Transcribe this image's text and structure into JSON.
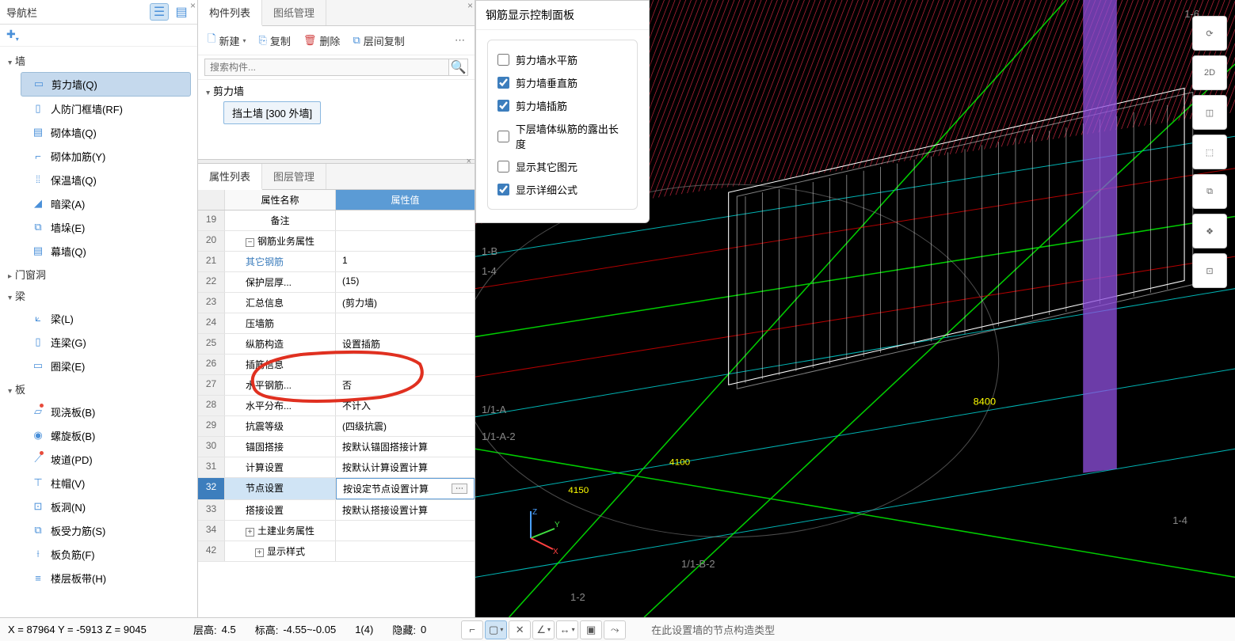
{
  "nav": {
    "title": "导航栏",
    "groups": [
      {
        "label": "墙",
        "expanded": true,
        "items": [
          {
            "label": "剪力墙(Q)",
            "selected": true,
            "icon": "▭"
          },
          {
            "label": "人防门框墙(RF)",
            "icon": "▯"
          },
          {
            "label": "砌体墙(Q)",
            "icon": "▤"
          },
          {
            "label": "砌体加筋(Y)",
            "icon": "⌐"
          },
          {
            "label": "保温墙(Q)",
            "icon": "⦙⦙"
          },
          {
            "label": "暗梁(A)",
            "icon": "◢"
          },
          {
            "label": "墙垛(E)",
            "icon": "⧉"
          },
          {
            "label": "幕墙(Q)",
            "icon": "▤"
          }
        ]
      },
      {
        "label": "门窗洞",
        "expanded": false
      },
      {
        "label": "梁",
        "expanded": true,
        "items": [
          {
            "label": "梁(L)",
            "icon": "⟀"
          },
          {
            "label": "连梁(G)",
            "icon": "▯"
          },
          {
            "label": "圈梁(E)",
            "icon": "▭"
          }
        ]
      },
      {
        "label": "板",
        "expanded": true,
        "items": [
          {
            "label": "现浇板(B)",
            "icon": "▱",
            "dot": true
          },
          {
            "label": "螺旋板(B)",
            "icon": "◉"
          },
          {
            "label": "坡道(PD)",
            "icon": "⟋",
            "dot": true
          },
          {
            "label": "柱帽(V)",
            "icon": "⊤"
          },
          {
            "label": "板洞(N)",
            "icon": "⊡"
          },
          {
            "label": "板受力筋(S)",
            "icon": "⧉"
          },
          {
            "label": "板负筋(F)",
            "icon": "⟊"
          },
          {
            "label": "楼层板带(H)",
            "icon": "≡"
          }
        ]
      }
    ]
  },
  "component": {
    "tabs": {
      "list_label": "构件列表",
      "drawing_label": "图纸管理"
    },
    "toolbar": {
      "new": "新建",
      "copy": "复制",
      "delete": "删除",
      "floor_copy": "层间复制"
    },
    "search_placeholder": "搜索构件...",
    "tree_group": "剪力墙",
    "tree_item": "挡土墙 [300 外墙]"
  },
  "props": {
    "tabs": {
      "prop_label": "属性列表",
      "layer_label": "图层管理"
    },
    "headers": {
      "name": "属性名称",
      "value": "属性值"
    },
    "rows": [
      {
        "num": "19",
        "name": "备注",
        "value": "",
        "indent": false
      },
      {
        "num": "20",
        "name": "钢筋业务属性",
        "value": "",
        "group": true,
        "exp": "−"
      },
      {
        "num": "21",
        "name": "其它钢筋",
        "value": "1",
        "indent": true,
        "link_name": true
      },
      {
        "num": "22",
        "name": "保护层厚...",
        "value": "(15)",
        "indent": true
      },
      {
        "num": "23",
        "name": "汇总信息",
        "value": "(剪力墙)",
        "indent": true
      },
      {
        "num": "24",
        "name": "压墙筋",
        "value": "",
        "indent": true
      },
      {
        "num": "25",
        "name": "纵筋构造",
        "value": "设置插筋",
        "indent": true
      },
      {
        "num": "26",
        "name": "插筋信息",
        "value": "",
        "indent": true
      },
      {
        "num": "27",
        "name": "水平钢筋...",
        "value": "否",
        "indent": true
      },
      {
        "num": "28",
        "name": "水平分布...",
        "value": "不计入",
        "indent": true
      },
      {
        "num": "29",
        "name": "抗震等级",
        "value": "(四级抗震)",
        "indent": true
      },
      {
        "num": "30",
        "name": "锚固搭接",
        "value": "按默认锚固搭接计算",
        "indent": true
      },
      {
        "num": "31",
        "name": "计算设置",
        "value": "按默认计算设置计算",
        "indent": true
      },
      {
        "num": "32",
        "name": "节点设置",
        "value": "按设定节点设置计算",
        "indent": true,
        "selected": true
      },
      {
        "num": "33",
        "name": "搭接设置",
        "value": "按默认搭接设置计算",
        "indent": true
      },
      {
        "num": "34",
        "name": "土建业务属性",
        "value": "",
        "group": true,
        "exp": "+"
      },
      {
        "num": "42",
        "name": "显示样式",
        "value": "",
        "group": true,
        "exp": "+"
      }
    ]
  },
  "rebar_panel": {
    "title": "钢筋显示控制面板",
    "items": [
      {
        "label": "剪力墙水平筋",
        "checked": false
      },
      {
        "label": "剪力墙垂直筋",
        "checked": true
      },
      {
        "label": "剪力墙插筋",
        "checked": true
      },
      {
        "label": "下层墙体纵筋的露出长度",
        "checked": false
      },
      {
        "label": "显示其它图元",
        "checked": false
      },
      {
        "label": "显示详细公式",
        "checked": true
      }
    ]
  },
  "viewport": {
    "tools": [
      "⟳",
      "2D",
      "◫",
      "⬚",
      "⧉",
      "❖",
      "⊡"
    ],
    "axis_labels": [
      "1-6",
      "1-B",
      "1-4",
      "1/1-A",
      "1/1-A-2",
      "1-4",
      "1/1-B-2",
      "1-2"
    ],
    "dims": [
      "8400",
      "4100",
      "4150"
    ]
  },
  "status": {
    "coords": "X = 87964 Y = -5913 Z = 9045",
    "floor_height_label": "层高:",
    "floor_height": "4.5",
    "level_label": "标高:",
    "level": "-4.55~-0.05",
    "info": "1(4)",
    "hidden_label": "隐藏:",
    "hidden": "0",
    "hint": "在此设置墙的节点构造类型"
  }
}
